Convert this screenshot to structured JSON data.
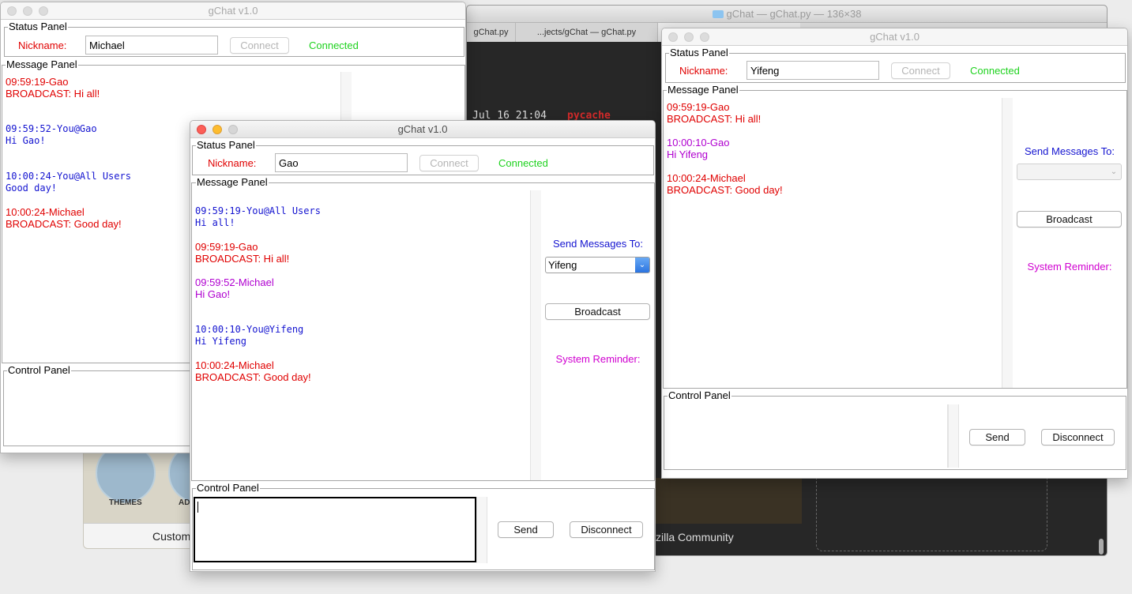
{
  "background": {
    "editor_title": "gChat — gChat.py — 136×38",
    "editor_tabs": [
      "gChat.py",
      "...jects/gChat — gChat.py"
    ],
    "terminal_line": "Jul 16 21:04",
    "terminal_dir": "pycache",
    "firefox_themes_label": "THEMES",
    "firefox_addons_label": "AD",
    "firefox_customize": "Custom",
    "community_text": "zilla Community"
  },
  "windows": {
    "michael": {
      "title": "gChat v1.0",
      "status_legend": "Status Panel",
      "nickname_label": "Nickname:",
      "nickname_value": "Michael",
      "connect_label": "Connect",
      "status_text": "Connected",
      "message_legend": "Message Panel",
      "messages": [
        {
          "head": "09:59:19-Gao",
          "body": "BROADCAST: Hi all!"
        },
        {
          "head": "09:59:52-You@Gao",
          "body": "Hi Gao!"
        },
        {
          "head": "10:00:24-You@All Users",
          "body": "Good day!"
        },
        {
          "head": "10:00:24-Michael",
          "body": "BROADCAST: Good day!"
        }
      ],
      "control_legend": "Control Panel"
    },
    "gao": {
      "title": "gChat v1.0",
      "status_legend": "Status Panel",
      "nickname_label": "Nickname:",
      "nickname_value": "Gao",
      "connect_label": "Connect",
      "status_text": "Connected",
      "message_legend": "Message Panel",
      "messages": [
        {
          "head": "09:59:19-You@All Users",
          "body": "Hi all!"
        },
        {
          "head": "09:59:19-Gao",
          "body": "BROADCAST: Hi all!"
        },
        {
          "head": "09:59:52-Michael",
          "body": "Hi Gao!"
        },
        {
          "head": "10:00:10-You@Yifeng",
          "body": "Hi Yifeng"
        },
        {
          "head": "10:00:24-Michael",
          "body": "BROADCAST: Good day!"
        }
      ],
      "send_to_label": "Send Messages To:",
      "send_to_value": "Yifeng",
      "broadcast_label": "Broadcast",
      "reminder_label": "System Reminder:",
      "control_legend": "Control Panel",
      "compose_value": "",
      "send_label": "Send",
      "disconnect_label": "Disconnect"
    },
    "yifeng": {
      "title": "gChat v1.0",
      "status_legend": "Status Panel",
      "nickname_label": "Nickname:",
      "nickname_value": "Yifeng",
      "connect_label": "Connect",
      "status_text": "Connected",
      "message_legend": "Message Panel",
      "messages": [
        {
          "head": "09:59:19-Gao",
          "body": "BROADCAST: Hi all!"
        },
        {
          "head": "10:00:10-Gao",
          "body": "Hi Yifeng"
        },
        {
          "head": "10:00:24-Michael",
          "body": "BROADCAST: Good day!"
        }
      ],
      "send_to_label": "Send Messages To:",
      "send_to_value": "",
      "broadcast_label": "Broadcast",
      "reminder_label": "System Reminder:",
      "control_legend": "Control Panel",
      "send_label": "Send",
      "disconnect_label": "Disconnect"
    }
  },
  "colors": {
    "broadcast": "#e00000",
    "private_sent": "#1414d0",
    "private_received": "#b000d0",
    "connected": "#1ed21e"
  }
}
